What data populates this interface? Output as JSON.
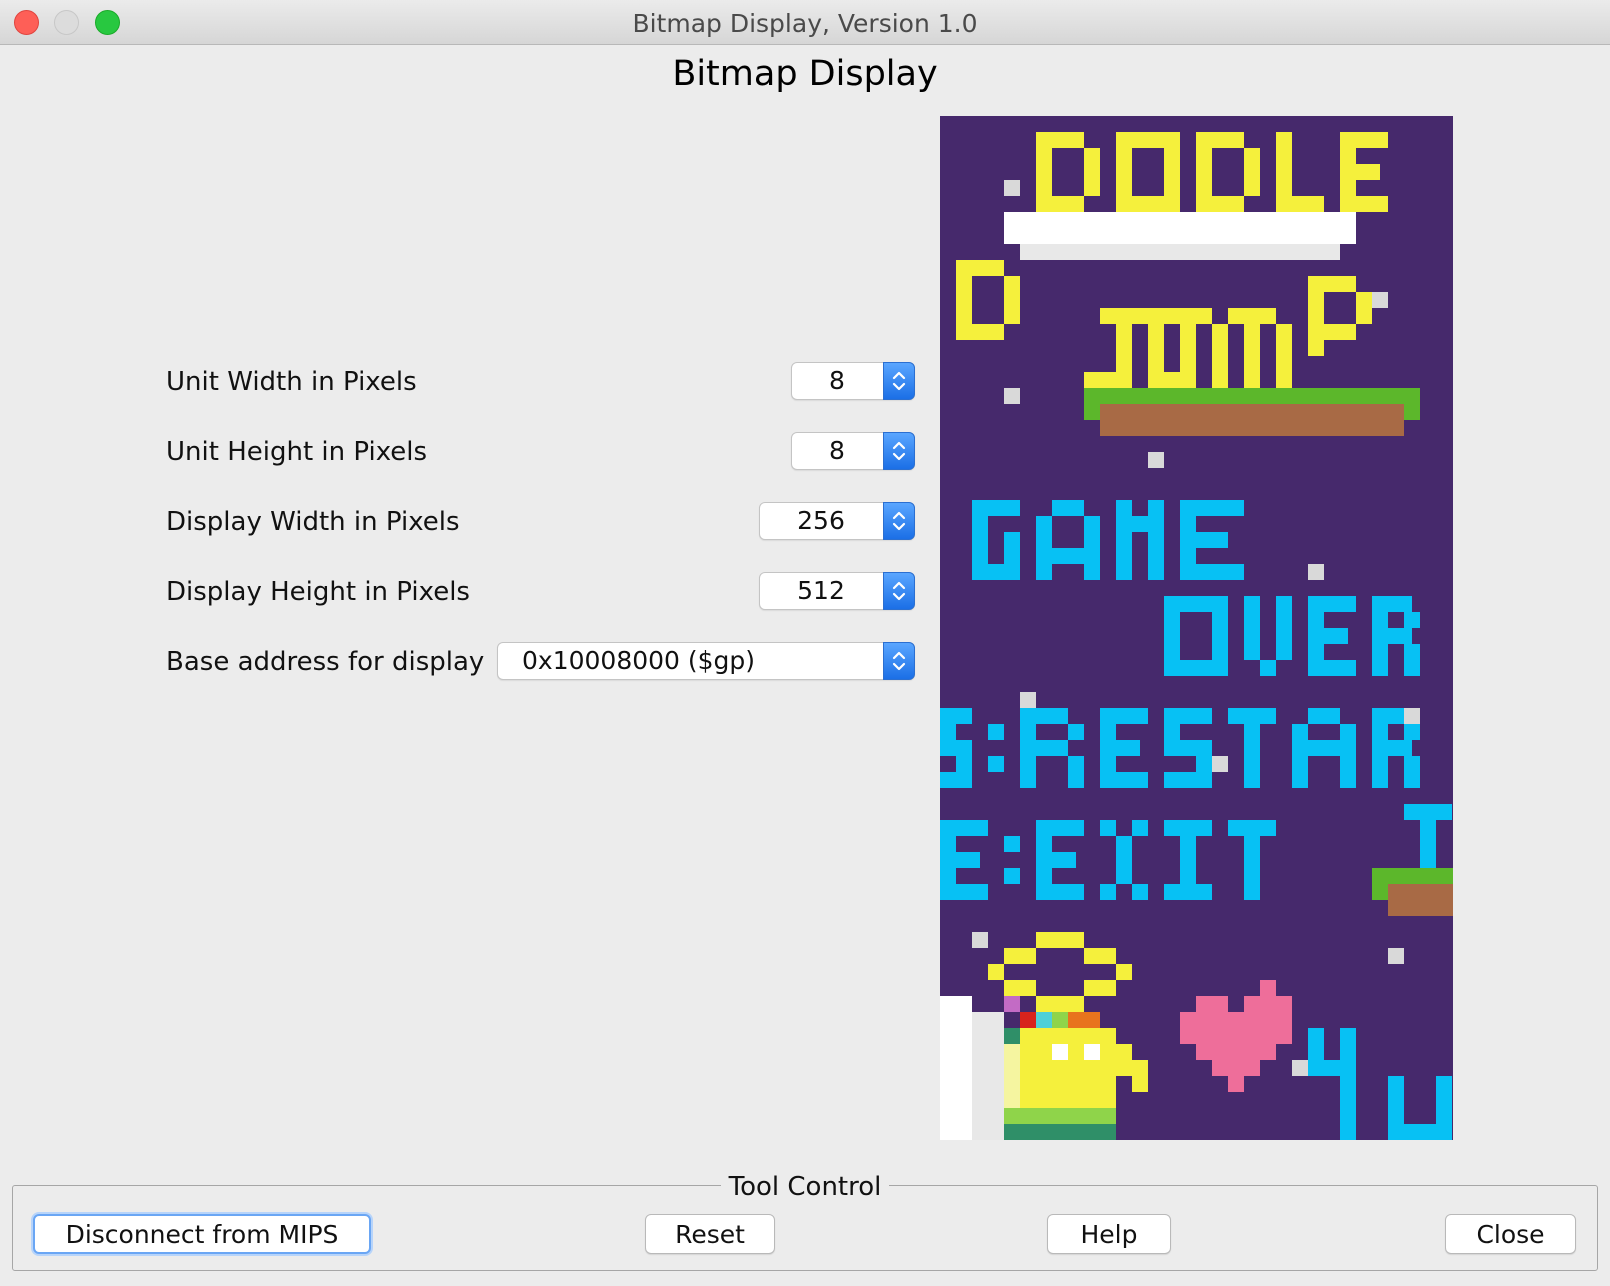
{
  "window": {
    "title": "Bitmap Display, Version 1.0",
    "heading": "Bitmap Display"
  },
  "settings": {
    "unit_width": {
      "label": "Unit Width in Pixels",
      "value": "8"
    },
    "unit_height": {
      "label": "Unit Height in Pixels",
      "value": "8"
    },
    "display_width": {
      "label": "Display Width in Pixels",
      "value": "256"
    },
    "display_height": {
      "label": "Display Height in Pixels",
      "value": "512"
    },
    "base_address": {
      "label": "Base address for display",
      "value": "0x10008000 ($gp)"
    }
  },
  "bitmap": {
    "background_color": "#46296c",
    "text_lines": [
      "DODLE",
      "D JUMP",
      "GAME",
      "OVER",
      "S:RESTAR",
      "E:EXIT",
      "YU"
    ]
  },
  "tool_control": {
    "legend": "Tool Control",
    "buttons": {
      "disconnect": "Disconnect from MIPS",
      "reset": "Reset",
      "help": "Help",
      "close": "Close"
    }
  },
  "colors": {
    "accent": "#1b6fe6",
    "yellow": "#f5f03c",
    "cyan": "#07c1f4",
    "green": "#5cb72b",
    "brown": "#a86a45",
    "pink": "#ee6e9a"
  }
}
